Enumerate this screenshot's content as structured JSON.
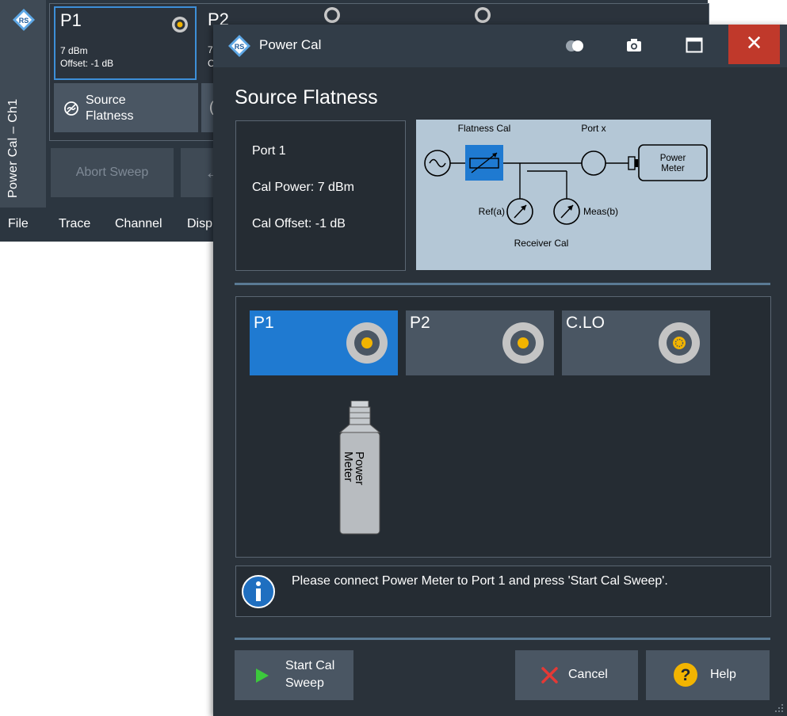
{
  "background_window": {
    "side_label": "Power Cal – Ch1",
    "port1": {
      "title": "P1",
      "power": "7 dBm",
      "offset": "Offset: -1 dB"
    },
    "port2": {
      "title": "P2",
      "power": "7",
      "offset": "C"
    },
    "source_flatness_button": "Source Flatness",
    "next_button_fragment": "(",
    "abort_sweep_button": "Abort Sweep",
    "arrow_button_glyph": "←",
    "menu": [
      "File",
      "Trace",
      "Channel",
      "Disp"
    ]
  },
  "dialog": {
    "title": "Power Cal",
    "close_glyph": "✕",
    "heading": "Source Flatness",
    "info": {
      "port": "Port 1",
      "cal_power": "Cal Power:  7 dBm",
      "cal_offset": "Cal Offset:  -1 dB"
    },
    "schematic": {
      "flatness_cal": "Flatness Cal",
      "port_x": "Port x",
      "power_meter_line1": "Power",
      "power_meter_line2": "Meter",
      "ref": "Ref(a)",
      "meas": "Meas(b)",
      "receiver_cal": "Receiver Cal"
    },
    "ports": [
      {
        "label": "P1",
        "selected": true
      },
      {
        "label": "P2",
        "selected": false
      },
      {
        "label": "C.LO",
        "selected": false
      }
    ],
    "power_meter_line1": "Power",
    "power_meter_line2": "Meter",
    "message": "Please connect Power Meter to Port 1 and press 'Start Cal Sweep'.",
    "buttons": {
      "start_line1": "Start Cal",
      "start_line2": "Sweep",
      "cancel": "Cancel",
      "help": "Help"
    }
  },
  "colors": {
    "accent_blue": "#1f7ad1",
    "close_red": "#c0392b",
    "connector_yellow": "#f2b400",
    "start_green": "#3cc83c",
    "cancel_red": "#e53935",
    "help_yellow": "#f2b400"
  },
  "icons": [
    "rs-logo-icon",
    "toggle-icon",
    "camera-icon",
    "maximize-icon",
    "close-icon",
    "info-icon",
    "play-icon",
    "cancel-x-icon",
    "help-icon",
    "connector-icon",
    "power-meter-icon"
  ]
}
